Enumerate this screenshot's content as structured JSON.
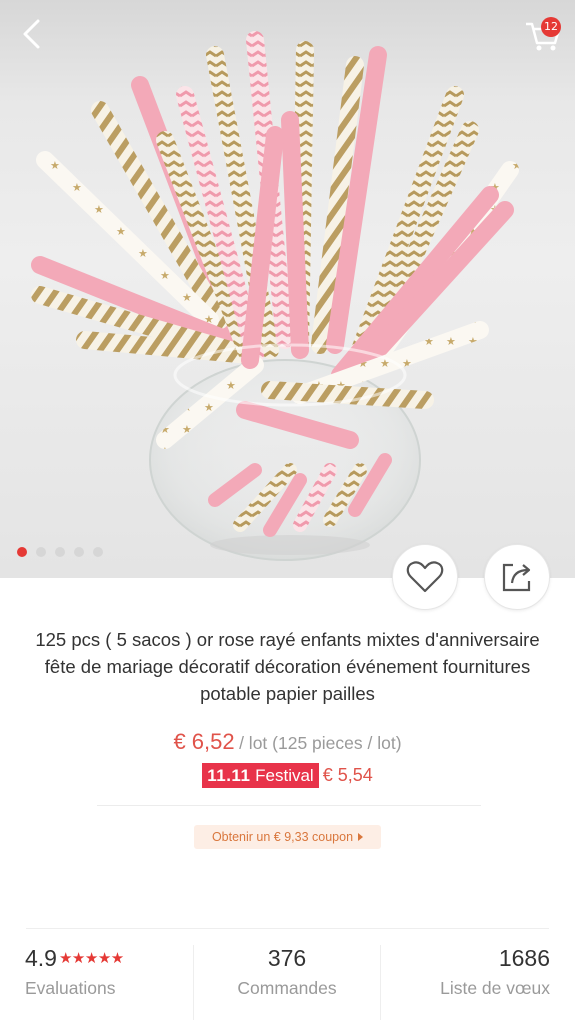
{
  "header": {
    "cart_count": "12",
    "icons": {
      "back": "chevron-left-icon",
      "cart": "shopping-cart-icon"
    }
  },
  "gallery": {
    "image": "product-photo-paper-straws-in-jar",
    "page_count": 5,
    "active_index": 0
  },
  "actions": {
    "wishlist": "heart-icon",
    "share": "share-icon"
  },
  "product": {
    "title": "125 pcs ( 5 sacos ) or rose rayé enfants mixtes d'anniversaire fête de mariage décoratif décoration événement fournitures potable papier pailles",
    "price": "€ 6,52",
    "unit": "/ lot (125 pieces / lot)",
    "festival_label_bold": "11.11",
    "festival_label": "Festival",
    "festival_price": "€ 5,54",
    "coupon": "Obtenir un € 9,33 coupon"
  },
  "stats": {
    "rating": "4.9",
    "stars": "★★★★★",
    "rating_label": "Evaluations",
    "orders": "376",
    "orders_label": "Commandes",
    "wishlist": "1686",
    "wishlist_label": "Liste de vœux"
  },
  "colors": {
    "accent": "#e53935",
    "price": "#e0534a",
    "festival_bg": "#e8334a",
    "coupon_bg": "#fdeee5",
    "coupon_text": "#d9773d",
    "straw_pink": "#f3a9b8",
    "straw_gold": "#bfa265"
  }
}
